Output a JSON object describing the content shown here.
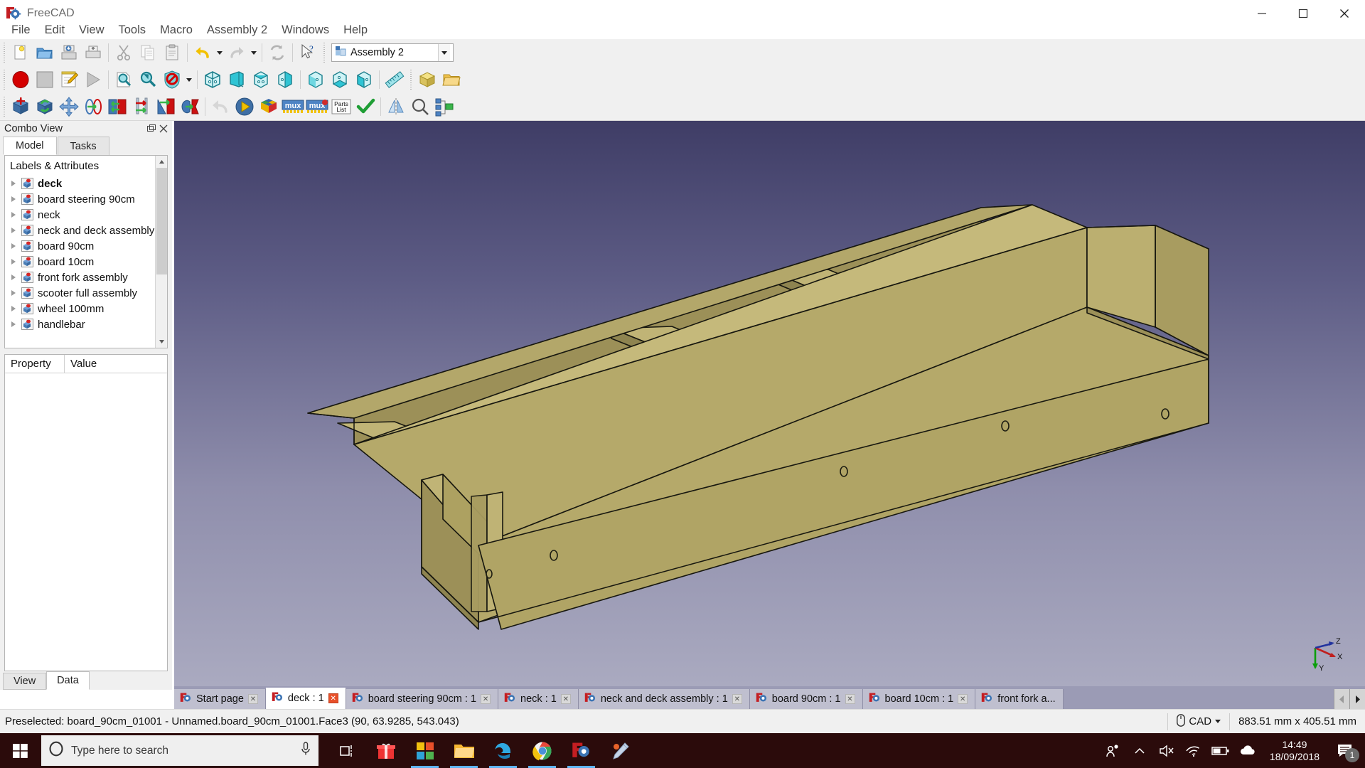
{
  "window": {
    "title": "FreeCAD",
    "app_icon": "freecad-icon",
    "minimize_label": "–",
    "maximize_label": "❐",
    "close_label": "✕"
  },
  "menubar": {
    "items": [
      {
        "label": "File",
        "name": "menu-file"
      },
      {
        "label": "Edit",
        "name": "menu-edit"
      },
      {
        "label": "View",
        "name": "menu-view"
      },
      {
        "label": "Tools",
        "name": "menu-tools"
      },
      {
        "label": "Macro",
        "name": "menu-macro"
      },
      {
        "label": "Assembly 2",
        "name": "menu-assembly2"
      },
      {
        "label": "Windows",
        "name": "menu-windows"
      },
      {
        "label": "Help",
        "name": "menu-help"
      }
    ]
  },
  "toolbar": {
    "workbench_selected": "Assembly 2",
    "row1": [
      {
        "name": "new-document-button",
        "icon": "new-file-icon"
      },
      {
        "name": "open-document-button",
        "icon": "open-folder-icon"
      },
      {
        "name": "save-document-button",
        "icon": "save-icon"
      },
      {
        "name": "print-document-button",
        "icon": "print-icon"
      },
      {
        "name": "cut-button",
        "icon": "scissors-icon"
      },
      {
        "name": "copy-button",
        "icon": "copy-icon"
      },
      {
        "name": "paste-button",
        "icon": "clipboard-icon"
      },
      {
        "name": "undo-button",
        "icon": "undo-arrow-icon"
      },
      {
        "name": "redo-button",
        "icon": "redo-arrow-icon"
      },
      {
        "name": "refresh-button",
        "icon": "refresh-icon"
      },
      {
        "name": "whats-this-button",
        "icon": "cursor-question-icon"
      }
    ],
    "row2": [
      {
        "name": "macro-record-button",
        "icon": "record-circle-icon"
      },
      {
        "name": "macro-stop-button",
        "icon": "stop-square-icon"
      },
      {
        "name": "macro-edit-button",
        "icon": "notepad-pencil-icon"
      },
      {
        "name": "macro-execute-button",
        "icon": "play-triangle-icon"
      },
      {
        "name": "fit-all-button",
        "icon": "magnifier-page-icon"
      },
      {
        "name": "fit-selection-button",
        "icon": "magnifier-arrow-icon"
      },
      {
        "name": "draw-style-button",
        "icon": "no-entry-icon"
      },
      {
        "name": "isometric-view-button",
        "icon": "cube-iso-icon"
      },
      {
        "name": "front-view-button",
        "icon": "cube-front-icon"
      },
      {
        "name": "top-view-button",
        "icon": "cube-top-icon"
      },
      {
        "name": "right-view-button",
        "icon": "cube-right-icon"
      },
      {
        "name": "rear-view-button",
        "icon": "cube-rear-icon"
      },
      {
        "name": "bottom-view-button",
        "icon": "cube-bottom-icon"
      },
      {
        "name": "left-view-button",
        "icon": "cube-left-icon"
      },
      {
        "name": "measure-button",
        "icon": "ruler-icon"
      },
      {
        "name": "create-part-button",
        "icon": "yellow-box-icon"
      },
      {
        "name": "create-group-button",
        "icon": "folder-icon"
      }
    ],
    "row3": [
      {
        "name": "import-part-button",
        "icon": "cube-plus-icon"
      },
      {
        "name": "update-part-button",
        "icon": "cube-refresh-icon"
      },
      {
        "name": "move-part-button",
        "icon": "move-arrows-icon"
      },
      {
        "name": "axial-constraint-button",
        "icon": "axial-constraint-icon"
      },
      {
        "name": "plane-constraint-button",
        "icon": "plane-constraint-icon"
      },
      {
        "name": "circular-edge-constraint-button",
        "icon": "circular-edge-icon"
      },
      {
        "name": "angle-constraint-button",
        "icon": "angle-constraint-icon"
      },
      {
        "name": "spherical-constraint-button",
        "icon": "spherical-constraint-icon"
      },
      {
        "name": "undo-constraint-button",
        "icon": "grey-undo-icon"
      },
      {
        "name": "solve-constraints-button",
        "icon": "solve-play-icon"
      },
      {
        "name": "degrees-of-freedom-button",
        "icon": "rubik-cube-icon"
      },
      {
        "name": "mux-assembly-button",
        "icon": "mux-icon"
      },
      {
        "name": "mux-assembly2-button",
        "icon": "mux2-icon"
      },
      {
        "name": "parts-list-button",
        "icon": "parts-list-icon"
      },
      {
        "name": "check-assembly-button",
        "icon": "green-check-icon"
      },
      {
        "name": "mirror-part-button",
        "icon": "mirror-icon"
      },
      {
        "name": "search-constraint-button",
        "icon": "magnifier-small-icon"
      },
      {
        "name": "tree-structure-button",
        "icon": "tree-structure-icon"
      }
    ]
  },
  "combo_view": {
    "title": "Combo View",
    "dock_float_name": "float-dock-icon",
    "dock_close_name": "close-dock-icon",
    "tabs": [
      {
        "label": "Model",
        "name": "tab-model",
        "active": true
      },
      {
        "label": "Tasks",
        "name": "tab-tasks",
        "active": false
      }
    ],
    "tree_header": "Labels & Attributes",
    "tree_items": [
      {
        "label": "deck",
        "bold": true
      },
      {
        "label": "board steering 90cm",
        "bold": false
      },
      {
        "label": "neck",
        "bold": false
      },
      {
        "label": "neck and deck assembly",
        "bold": false
      },
      {
        "label": "board 90cm",
        "bold": false
      },
      {
        "label": "board 10cm",
        "bold": false
      },
      {
        "label": "front fork assembly",
        "bold": false
      },
      {
        "label": "scooter full assembly",
        "bold": false
      },
      {
        "label": "wheel 100mm",
        "bold": false
      },
      {
        "label": "handlebar",
        "bold": false
      }
    ],
    "property_columns": [
      "Property",
      "Value"
    ],
    "bottom_tabs": [
      {
        "label": "View",
        "name": "tab-view",
        "active": false
      },
      {
        "label": "Data",
        "name": "tab-data",
        "active": true
      }
    ]
  },
  "view3d": {
    "axis_labels": {
      "x": "X",
      "y": "Y",
      "z": "Z"
    },
    "model_name": "scooter-deck-3d-model"
  },
  "mdi_tabs": [
    {
      "label": "Start page",
      "active": false
    },
    {
      "label": "deck : 1",
      "active": true
    },
    {
      "label": "board steering 90cm : 1",
      "active": false
    },
    {
      "label": "neck : 1",
      "active": false
    },
    {
      "label": "neck and deck assembly : 1",
      "active": false
    },
    {
      "label": "board 90cm : 1",
      "active": false
    },
    {
      "label": "board 10cm : 1",
      "active": false
    },
    {
      "label": "front fork a...",
      "active": false
    }
  ],
  "statusbar": {
    "message": "Preselected: board_90cm_01001 - Unnamed.board_90cm_01001.Face3 (90, 63.9285, 543.043)",
    "nav_style": "CAD",
    "nav_icon": "mouse-icon",
    "dimensions": "883.51 mm x 405.51 mm"
  },
  "taskbar": {
    "start_name": "windows-start-button",
    "search_placeholder": "Type here to search",
    "cortana_icon": "cortana-circle-icon",
    "mic_icon": "microphone-icon",
    "task_view_icon": "task-view-icon",
    "apps": [
      {
        "name": "taskbar-app-store-gift",
        "icon": "gift-icon"
      },
      {
        "name": "taskbar-app-microsoft-store",
        "icon": "store-icon"
      },
      {
        "name": "taskbar-app-file-explorer",
        "icon": "folder-explorer-icon"
      },
      {
        "name": "taskbar-app-edge",
        "icon": "edge-icon"
      },
      {
        "name": "taskbar-app-chrome",
        "icon": "chrome-icon"
      },
      {
        "name": "taskbar-app-freecad",
        "icon": "freecad-icon"
      },
      {
        "name": "taskbar-app-snip",
        "icon": "snip-sketch-icon"
      }
    ],
    "tray": [
      {
        "name": "people-icon"
      },
      {
        "name": "show-hidden-icons-chevron"
      },
      {
        "name": "volume-muted-icon"
      },
      {
        "name": "wifi-icon"
      },
      {
        "name": "battery-icon"
      },
      {
        "name": "onedrive-cloud-icon"
      }
    ],
    "time": "14:49",
    "date": "18/09/2018",
    "notification_icon": "notification-icon",
    "notification_count": "1"
  },
  "colors": {
    "accent_blue": "#2f7fd0",
    "view_top": "#3f3d66",
    "view_bottom": "#a9a9c0",
    "model_fill": "#b5a96a",
    "taskbar_bg": "#2b0b0b",
    "active_tab_close": "#e8502a"
  }
}
